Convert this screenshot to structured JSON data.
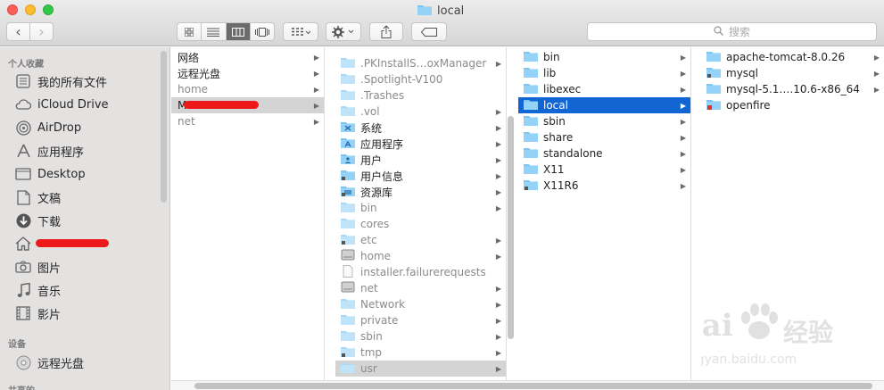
{
  "window": {
    "title": "local"
  },
  "toolbar": {
    "back": "‹",
    "forward": "›",
    "search_placeholder": "搜索"
  },
  "sidebar": {
    "favorites_header": "个人收藏",
    "favorites": [
      {
        "label": "我的所有文件",
        "icon": "all-files-icon"
      },
      {
        "label": "iCloud Drive",
        "icon": "cloud-icon"
      },
      {
        "label": "AirDrop",
        "icon": "airdrop-icon"
      },
      {
        "label": "应用程序",
        "icon": "applications-icon"
      },
      {
        "label": "Desktop",
        "icon": "desktop-icon"
      },
      {
        "label": "文稿",
        "icon": "documents-icon"
      },
      {
        "label": "下载",
        "icon": "download-icon"
      },
      {
        "label": "",
        "icon": "home-icon"
      },
      {
        "label": "图片",
        "icon": "camera-icon"
      },
      {
        "label": "音乐",
        "icon": "music-icon"
      },
      {
        "label": "影片",
        "icon": "film-icon"
      }
    ],
    "devices_header": "设备",
    "devices": [
      {
        "label": "远程光盘",
        "icon": "disc-icon"
      }
    ],
    "shared_header": "共享的"
  },
  "columns": [
    {
      "items": [
        {
          "label": "网络"
        },
        {
          "label": "远程光盘"
        },
        {
          "label": "home"
        },
        {
          "label": "M"
        },
        {
          "label": "net"
        }
      ]
    },
    {
      "items": [
        {
          "label": ".PKInstallS…oxManager"
        },
        {
          "label": ".Spotlight-V100"
        },
        {
          "label": ".Trashes"
        },
        {
          "label": ".vol"
        },
        {
          "label": "系统"
        },
        {
          "label": "应用程序"
        },
        {
          "label": "用户"
        },
        {
          "label": "用户信息"
        },
        {
          "label": "资源库"
        },
        {
          "label": "bin"
        },
        {
          "label": "cores"
        },
        {
          "label": "etc"
        },
        {
          "label": "home"
        },
        {
          "label": "installer.failurerequests"
        },
        {
          "label": "net"
        },
        {
          "label": "Network"
        },
        {
          "label": "private"
        },
        {
          "label": "sbin"
        },
        {
          "label": "tmp"
        },
        {
          "label": "usr"
        }
      ]
    },
    {
      "items": [
        {
          "label": "bin"
        },
        {
          "label": "lib"
        },
        {
          "label": "libexec"
        },
        {
          "label": "local"
        },
        {
          "label": "sbin"
        },
        {
          "label": "share"
        },
        {
          "label": "standalone"
        },
        {
          "label": "X11"
        },
        {
          "label": "X11R6"
        }
      ]
    },
    {
      "items": [
        {
          "label": "apache-tomcat-8.0.26"
        },
        {
          "label": "mysql"
        },
        {
          "label": "mysql-5.1….10.6-x86_64"
        },
        {
          "label": "openfire"
        }
      ]
    }
  ],
  "colors": {
    "selection": "#1166d4",
    "folder": "#7ec6f2",
    "sidebar_bg": "#e4e1e1"
  },
  "watermark": {
    "brand": "Bai",
    "suffix": "经验",
    "url": "jingyan.baidu.com"
  }
}
